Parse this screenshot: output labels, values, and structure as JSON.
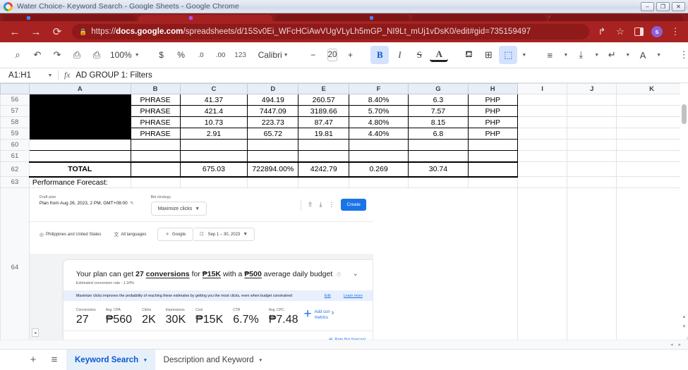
{
  "window": {
    "title": "Water Choice- Keyword Search - Google Sheets - Google Chrome",
    "minimize_label": "–",
    "maximize_label": "❐",
    "close_label": "✕"
  },
  "browser": {
    "back_icon": "←",
    "forward_icon": "→",
    "reload_icon": "⟳",
    "lock_icon": "ὑ2",
    "url_prefix": "https://",
    "url_domain": "docs.google.com",
    "url_suffix": "/spreadsheets/d/15Sv0Ei_WFcHCiAwVUgVLyLh5mGP_NI9Lt_mUj1vDsK0/edit#gid=735159497",
    "share_icon": "↱",
    "bookmark_icon": "☆",
    "side_panel_icon": "side-panel",
    "profile_initial": "s",
    "menu_icon": "⋮"
  },
  "toolbar": {
    "search_icon": "⌕",
    "undo_icon": "↶",
    "redo_icon": "↷",
    "print_icon": "⎙",
    "paint_format_icon": "⎙",
    "zoom_value": "100%",
    "currency_icon": "$",
    "percent_icon": "%",
    "decrease_decimal_icon": ".0",
    "increase_decimal_icon": ".00",
    "more_formats_icon": "123",
    "font_name": "Calibri",
    "font_size_minus": "−",
    "font_size": "20",
    "font_size_plus": "+",
    "bold_icon": "B",
    "italic_icon": "I",
    "strikethrough_icon": "S",
    "text_color_icon": "A",
    "fill_color_icon": "⛾",
    "borders_icon": "⊞",
    "merge_icon": "⬚",
    "align_icon": "≡",
    "valign_icon": "⤓",
    "wrap_icon": "↵",
    "rotate_icon": "A",
    "more_icon": "⋮",
    "collapse_icon": "⌄"
  },
  "formula_bar": {
    "name_box": "A1:H1",
    "fx_label": "fx",
    "value": "AD GROUP 1: Filters"
  },
  "grid": {
    "columns": [
      "A",
      "B",
      "C",
      "D",
      "E",
      "F",
      "G",
      "H",
      "I",
      "J",
      "K"
    ],
    "rows": [
      {
        "num": "56",
        "cells": [
          "",
          "PHRASE",
          "41.37",
          "494.19",
          "260.57",
          "8.40%",
          "6.3",
          "PHP"
        ],
        "a_black": true
      },
      {
        "num": "57",
        "cells": [
          "",
          "PHRASE",
          "421.4",
          "7447.09",
          "3189.66",
          "5.70%",
          "7.57",
          "PHP"
        ],
        "a_black": true
      },
      {
        "num": "58",
        "cells": [
          "",
          "PHRASE",
          "10.73",
          "223.73",
          "87.47",
          "4.80%",
          "8.15",
          "PHP"
        ],
        "a_black": true
      },
      {
        "num": "59",
        "cells": [
          "",
          "PHRASE",
          "2.91",
          "65.72",
          "19.81",
          "4.40%",
          "6.8",
          "PHP"
        ],
        "a_black": true
      },
      {
        "num": "60",
        "cells": [
          "",
          "",
          "",
          "",
          "",
          "",
          "",
          ""
        ],
        "a_black": false
      },
      {
        "num": "61",
        "cells": [
          "",
          "",
          "",
          "",
          "",
          "",
          "",
          ""
        ],
        "a_black": false
      },
      {
        "num": "62",
        "cells": [
          "TOTAL",
          "",
          "675.03",
          "722894.00%",
          "4242.79",
          "0.269",
          "30.74",
          ""
        ],
        "a_black": false,
        "total": true
      },
      {
        "num": "63",
        "cells": [
          "Performance Forecast:",
          "",
          "",
          "",
          "",
          "",
          "",
          ""
        ],
        "a_black": false,
        "label_row": true
      },
      {
        "num": "64",
        "cells": [
          "",
          "",
          "",
          "",
          "",
          "",
          "",
          ""
        ],
        "a_black": false,
        "image_row": true
      }
    ]
  },
  "forecast_image": {
    "draft_plan_label": "Draft plan",
    "draft_plan_value": "Plan from Aug 26, 2023, 2 PM, GMT+08:00",
    "edit_pencil_icon": "✎",
    "bid_strategy_label": "Bid strategy",
    "bid_strategy_value": "Maximize clicks",
    "share_icon": "⇧",
    "download_icon": "⤓",
    "more_icon": "⋮",
    "create_button": "Create",
    "location_icon": "⌘",
    "location_value": "Philippines and United States",
    "language_icon": "文",
    "language_value": "All languages",
    "network_icon": "G",
    "network_value": "Google",
    "calendar_icon": "Ὄ5",
    "date_range_value": "Sep 1 – 30, 2023",
    "headline_prefix": "Your plan can get",
    "headline_conversions_num": "27",
    "headline_conversions_word": "conversions",
    "headline_for": "for",
    "headline_cost": "₱15K",
    "headline_with": "with a",
    "headline_budget": "₱500",
    "headline_suffix": "average daily budget",
    "info_icon": "ⓘ",
    "collapse_icon": "⌄",
    "subtitle": "Estimated conversion rate : 1.34%",
    "banner_text": "Maximize clicks improves the probability of reaching these estimates by getting you the most clicks, even when budget constrained",
    "banner_edit": "Edit",
    "banner_learn_more": "Learn more",
    "metrics": [
      {
        "label": "Conversions",
        "value": "27"
      },
      {
        "label": "Avg. CPA",
        "value": "₱560"
      },
      {
        "label": "Clicks",
        "value": "2K"
      },
      {
        "label": "Impressions",
        "value": "30K"
      },
      {
        "label": "Cost",
        "value": "₱15K"
      },
      {
        "label": "CTR",
        "value": "6.7%"
      },
      {
        "label": "Avg. CPC",
        "value": "₱7.48"
      }
    ],
    "add_metrics_plus": "+",
    "add_metrics_line1": "Add con",
    "add_metrics_line2": "metrics",
    "next_arrow": "›",
    "rate_forecast_icon": "▤",
    "rate_forecast_label": "Rate this forecast",
    "scroll_left_icon": "◂"
  },
  "sheet_bar": {
    "add_sheet_icon": "+",
    "all_sheets_icon": "≡",
    "tabs": [
      {
        "label": "Keyword Search",
        "caret": "▾",
        "active": true
      },
      {
        "label": "Description and Keyword",
        "caret": "▾",
        "active": false
      }
    ]
  },
  "scroll": {
    "left_arrow": "◂",
    "right_arrow": "▸",
    "up_arrow": "▴",
    "down_arrow": "▾"
  },
  "colors": {
    "chrome_red": "#a82222",
    "sheets_blue": "#0b57d0",
    "ads_blue": "#1a73e8",
    "header_blue": "#e8eef7"
  }
}
